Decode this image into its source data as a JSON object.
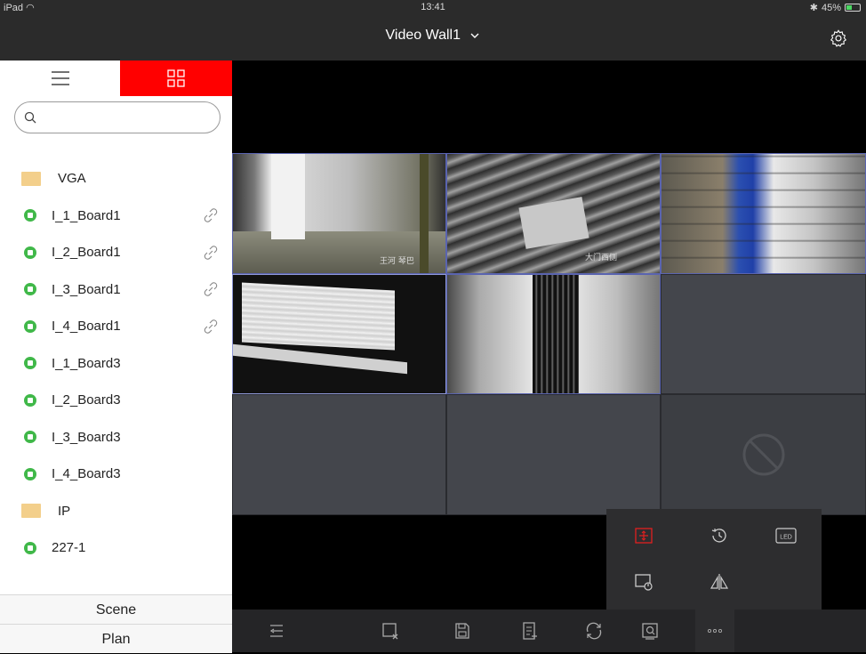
{
  "status_bar": {
    "device": "iPad",
    "time": "13:41",
    "battery": "45%",
    "battery_fraction": 0.45
  },
  "header": {
    "title": "Video Wall1"
  },
  "sidebar": {
    "search_placeholder": "",
    "tree": [
      {
        "type": "folder",
        "label": "VGA"
      },
      {
        "type": "camera",
        "label": "I_1_Board1",
        "linked": true
      },
      {
        "type": "camera",
        "label": "I_2_Board1",
        "linked": true
      },
      {
        "type": "camera",
        "label": "I_3_Board1",
        "linked": true
      },
      {
        "type": "camera",
        "label": "I_4_Board1",
        "linked": true
      },
      {
        "type": "camera",
        "label": "I_1_Board3",
        "linked": false
      },
      {
        "type": "camera",
        "label": "I_2_Board3",
        "linked": false
      },
      {
        "type": "camera",
        "label": "I_3_Board3",
        "linked": false
      },
      {
        "type": "camera",
        "label": "I_4_Board3",
        "linked": false
      },
      {
        "type": "folder",
        "label": "IP"
      },
      {
        "type": "camera",
        "label": "227-1",
        "linked": false
      }
    ],
    "bottom_tabs": [
      "Scene",
      "Plan"
    ]
  },
  "wall": {
    "osd": {
      "cell1": "王河 琴巴",
      "cell2": "大门西侧"
    }
  },
  "more_menu": [
    "roaming-window-icon",
    "history-icon",
    "led-icon",
    "screen-off-icon",
    "mirror-icon"
  ],
  "more_menu_led_label": "LED",
  "toolbar": [
    "collapse-list-icon",
    "close-window-icon",
    "save-icon",
    "add-scene-icon",
    "refresh-icon",
    "zoom-window-icon",
    "more-icon"
  ],
  "colors": {
    "accent": "#ff0000",
    "camera_online": "#40b849",
    "folder": "#f3cf8b"
  }
}
